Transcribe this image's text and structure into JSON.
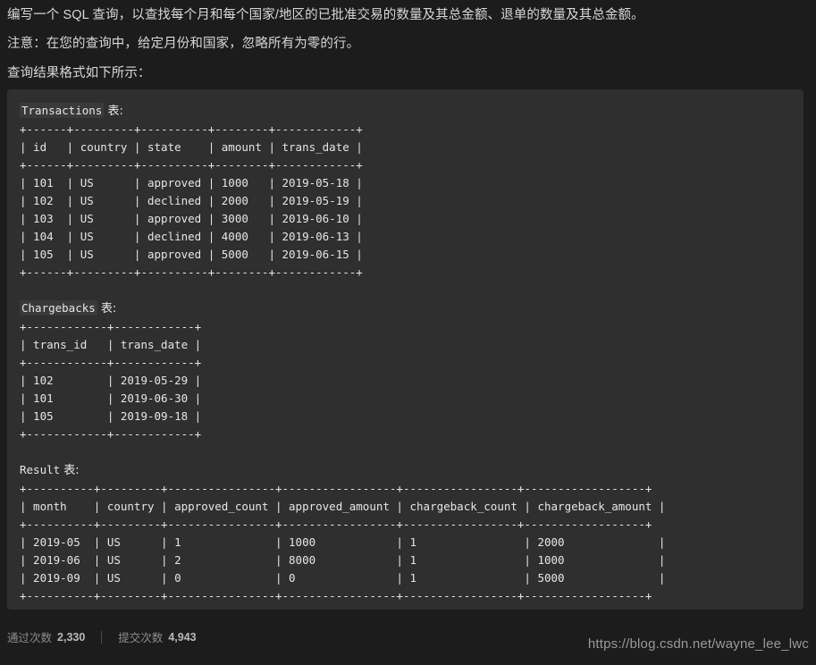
{
  "page": {
    "background_color": "#1c1c1c",
    "codeblock_color": "#2f2f2f",
    "text_color": "#d8d8d8"
  },
  "prose": {
    "paragraphs": [
      "编写一个 SQL 查询，以查找每个月和每个国家/地区的已批准交易的数量及其总金额、退单的数量及其总金额。",
      "注意：在您的查询中，给定月份和国家，忽略所有为零的行。",
      "查询结果格式如下所示："
    ]
  },
  "codeblock": {
    "tables": [
      {
        "name": "Transactions",
        "title_suffix": " 表:",
        "border": "+------+---------+----------+--------+------------+",
        "header": "| id   | country | state    | amount | trans_date |",
        "columns": [
          "id",
          "country",
          "state",
          "amount",
          "trans_date"
        ],
        "rows": [
          "| 101  | US      | approved | 1000   | 2019-05-18 |",
          "| 102  | US      | declined | 2000   | 2019-05-19 |",
          "| 103  | US      | approved | 3000   | 2019-06-10 |",
          "| 104  | US      | declined | 4000   | 2019-06-13 |",
          "| 105  | US      | approved | 5000   | 2019-06-15 |"
        ],
        "data": [
          {
            "id": "101",
            "country": "US",
            "state": "approved",
            "amount": "1000",
            "trans_date": "2019-05-18"
          },
          {
            "id": "102",
            "country": "US",
            "state": "declined",
            "amount": "2000",
            "trans_date": "2019-05-19"
          },
          {
            "id": "103",
            "country": "US",
            "state": "approved",
            "amount": "3000",
            "trans_date": "2019-06-10"
          },
          {
            "id": "104",
            "country": "US",
            "state": "declined",
            "amount": "4000",
            "trans_date": "2019-06-13"
          },
          {
            "id": "105",
            "country": "US",
            "state": "approved",
            "amount": "5000",
            "trans_date": "2019-06-15"
          }
        ]
      },
      {
        "name": "Chargebacks",
        "title_suffix": " 表:",
        "border": "+------------+------------+",
        "header": "| trans_id   | trans_date |",
        "columns": [
          "trans_id",
          "trans_date"
        ],
        "rows": [
          "| 102        | 2019-05-29 |",
          "| 101        | 2019-06-30 |",
          "| 105        | 2019-09-18 |"
        ],
        "data": [
          {
            "trans_id": "102",
            "trans_date": "2019-05-29"
          },
          {
            "trans_id": "101",
            "trans_date": "2019-06-30"
          },
          {
            "trans_id": "105",
            "trans_date": "2019-09-18"
          }
        ]
      },
      {
        "name": "Result",
        "title_suffix": " 表:",
        "border": "+----------+---------+----------------+-----------------+-----------------+------------------+",
        "header": "| month    | country | approved_count | approved_amount | chargeback_count | chargeback_amount |",
        "columns": [
          "month",
          "country",
          "approved_count",
          "approved_amount",
          "chargeback_count",
          "chargeback_amount"
        ],
        "rows": [
          "| 2019-05  | US      | 1              | 1000            | 1                | 2000              |",
          "| 2019-06  | US      | 2              | 8000            | 1                | 1000              |",
          "| 2019-09  | US      | 0              | 0               | 1                | 5000              |"
        ],
        "data": [
          {
            "month": "2019-05",
            "country": "US",
            "approved_count": "1",
            "approved_amount": "1000",
            "chargeback_count": "1",
            "chargeback_amount": "2000"
          },
          {
            "month": "2019-06",
            "country": "US",
            "approved_count": "2",
            "approved_amount": "8000",
            "chargeback_count": "1",
            "chargeback_amount": "1000"
          },
          {
            "month": "2019-09",
            "country": "US",
            "approved_count": "0",
            "approved_amount": "0",
            "chargeback_count": "1",
            "chargeback_amount": "5000"
          }
        ]
      }
    ]
  },
  "footer": {
    "passed_label": "通过次数",
    "passed_value": "2,330",
    "submitted_label": "提交次数",
    "submitted_value": "4,943",
    "watermark": "https://blog.csdn.net/wayne_lee_lwc"
  }
}
